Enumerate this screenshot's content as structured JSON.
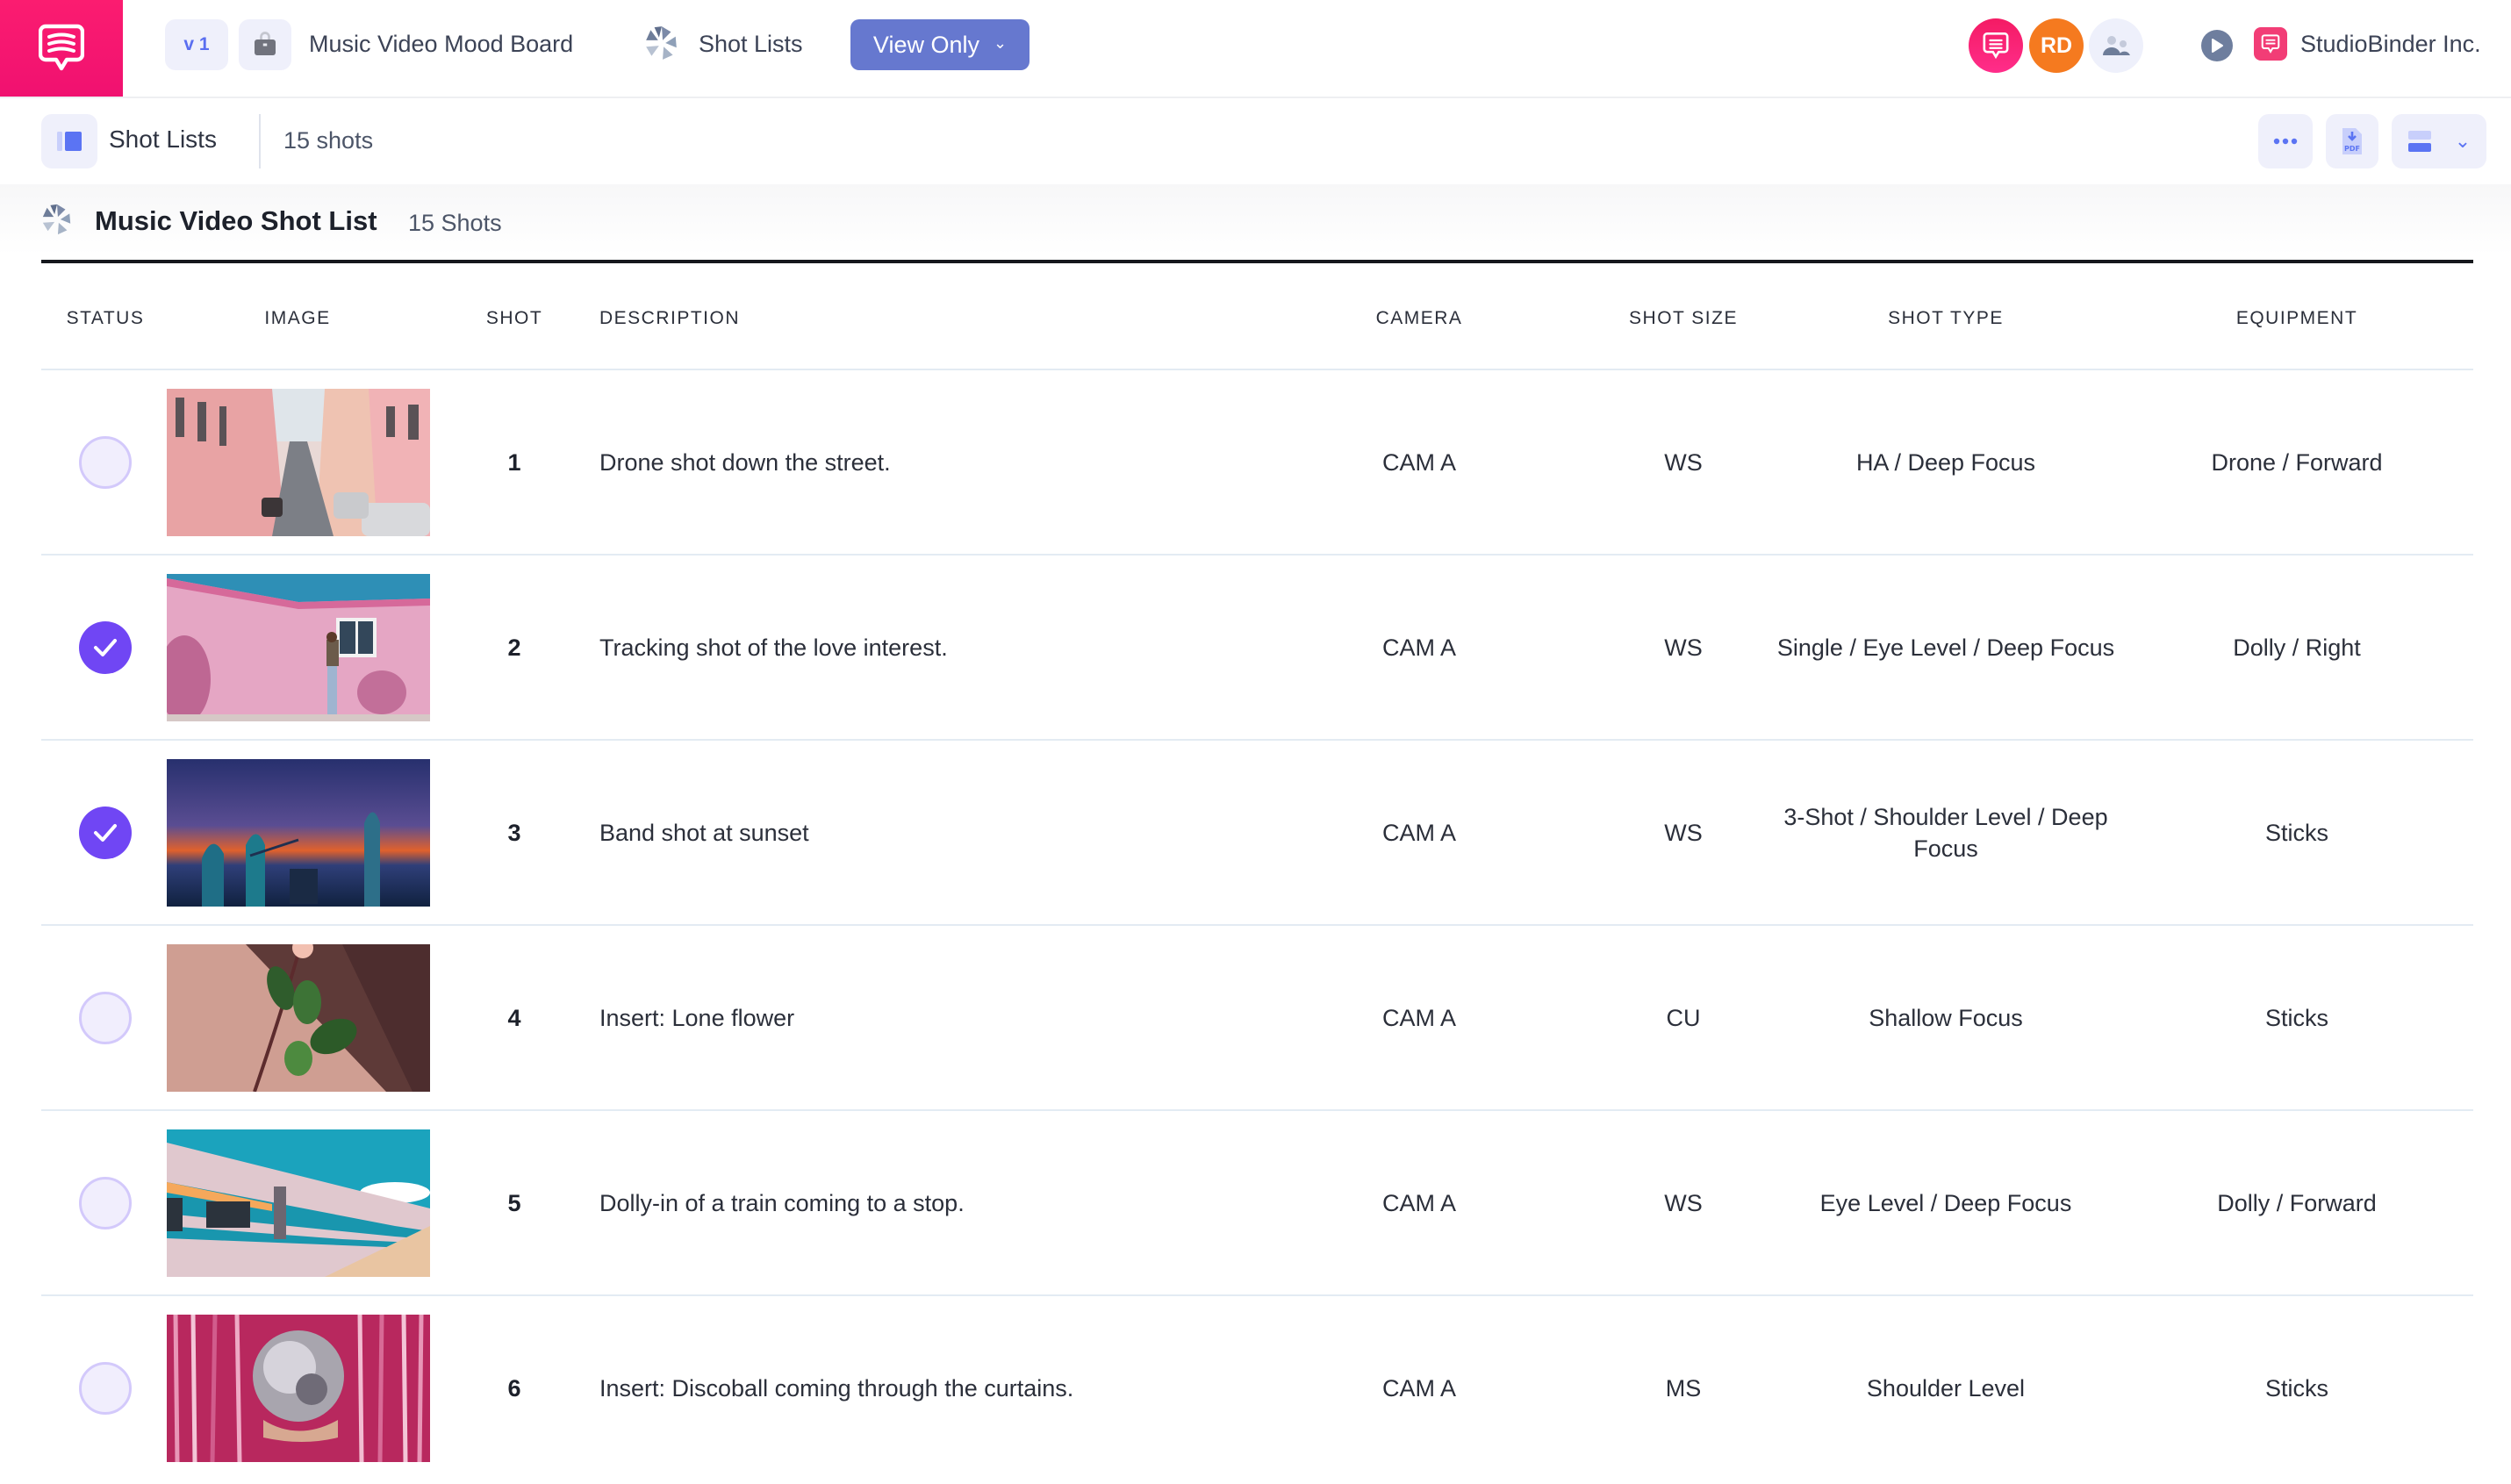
{
  "topbar": {
    "version_label": "v 1",
    "project_title": "Music Video Mood Board",
    "section_label": "Shot Lists",
    "permission_button": "View Only",
    "avatar_initials": "RD",
    "org_name": "StudioBinder Inc."
  },
  "subbar": {
    "title": "Shot Lists",
    "count": "15 shots",
    "export_label": "PDF"
  },
  "list": {
    "title": "Music Video Shot List",
    "count": "15 Shots"
  },
  "columns": {
    "status": "STATUS",
    "image": "IMAGE",
    "shot": "SHOT",
    "description": "DESCRIPTION",
    "camera": "CAMERA",
    "shot_size": "SHOT SIZE",
    "shot_type": "SHOT TYPE",
    "equipment": "EQUIPMENT"
  },
  "rows": [
    {
      "done": false,
      "image": "street",
      "shot": "1",
      "description": "Drone shot down the street.",
      "camera": "CAM A",
      "shot_size": "WS",
      "shot_type": "HA / Deep Focus",
      "equipment": "Drone / Forward"
    },
    {
      "done": true,
      "image": "pink-wall",
      "shot": "2",
      "description": "Tracking shot of the love interest.",
      "camera": "CAM A",
      "shot_size": "WS",
      "shot_type": "Single / Eye Level / Deep Focus",
      "equipment": "Dolly / Right"
    },
    {
      "done": true,
      "image": "band-sunset",
      "shot": "3",
      "description": "Band shot at sunset",
      "camera": "CAM A",
      "shot_size": "WS",
      "shot_type": "3-Shot / Shoulder Level / Deep Focus",
      "equipment": "Sticks"
    },
    {
      "done": false,
      "image": "flower",
      "shot": "4",
      "description": "Insert: Lone flower",
      "camera": "CAM A",
      "shot_size": "CU",
      "shot_type": "Shallow Focus",
      "equipment": "Sticks"
    },
    {
      "done": false,
      "image": "train",
      "shot": "5",
      "description": "Dolly-in of a train coming to a stop.",
      "camera": "CAM A",
      "shot_size": "WS",
      "shot_type": "Eye Level / Deep Focus",
      "equipment": "Dolly / Forward"
    },
    {
      "done": false,
      "image": "discoball",
      "shot": "6",
      "description": "Insert: Discoball coming through the curtains.",
      "camera": "CAM A",
      "shot_size": "MS",
      "shot_type": "Shoulder Level",
      "equipment": "Sticks"
    }
  ],
  "colors": {
    "brand_pink": "#f5166f",
    "accent_blue": "#6678cf",
    "check_purple": "#7046f4",
    "avatar_orange": "#f57a1f"
  }
}
